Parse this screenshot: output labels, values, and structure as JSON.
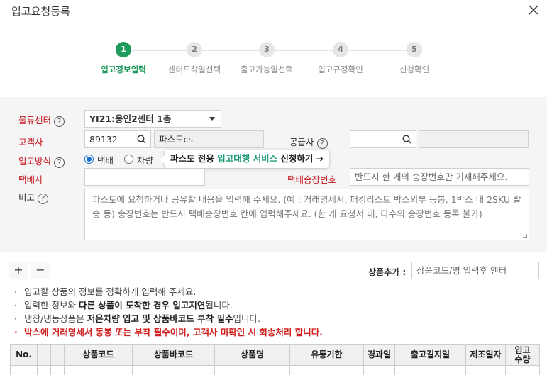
{
  "dialog": {
    "title": "입고요청등록"
  },
  "steps": [
    {
      "num": "1",
      "label": "입고정보입력",
      "active": true
    },
    {
      "num": "2",
      "label": "센터도착일선택",
      "active": false
    },
    {
      "num": "3",
      "label": "출고가능일선택",
      "active": false
    },
    {
      "num": "4",
      "label": "입고규정확인",
      "active": false
    },
    {
      "num": "5",
      "label": "신청확인",
      "active": false
    }
  ],
  "form": {
    "center_label": "물류센터",
    "center_value": "YI21:용인2센터 1층",
    "customer_label": "고객사",
    "customer_code": "89132",
    "customer_name": "파스토cs",
    "supplier_label": "공급사",
    "supplier_code": "",
    "supplier_name": "",
    "method_label": "입고방식",
    "method_options": [
      "택배",
      "차량"
    ],
    "method_selected": "택배",
    "promo_prefix": "파스토 전용 ",
    "promo_highlight": "입고대행 서비스",
    "promo_suffix": " 신청하기 ➔",
    "courier_label": "택배사",
    "courier_value": "",
    "invoice_label": "택배송장번호",
    "invoice_placeholder": "반드시 한 개의 송장번호만 기재해주세요.",
    "memo_label": "비고",
    "memo_placeholder": "파스토에 요청하거나 공유할 내용을 입력해 주세요. (예 : 거래명세서, 패킹리스트 박스외부 동봉, 1박스 내 2SKU 발송 등) 송장번호는 반드시 택배송장번호 칸에 입력해주세요. (한 개 요청서 내, 다수의 송장번호 등록 불가)"
  },
  "toolbar": {
    "add": "+",
    "remove": "−",
    "product_add_label": "상품추가 :",
    "product_add_placeholder": "상품코드/명 입력후 엔터"
  },
  "notes": {
    "line1": "입고할 상품의 정보를 정확하게 입력해 주세요.",
    "line2_a": "입력한 정보와 ",
    "line2_b": "다른 상품이 도착한 경우 입고지연",
    "line2_c": "됩니다.",
    "line3_a": "냉장/냉동상품은 ",
    "line3_b": "저온차량 입고 및 상품바코드 부착 필수",
    "line3_c": "입니다.",
    "line4": "박스에 거래명세서 동봉 또는 부착 필수이며, 고객사 미확인 시 회송처리 합니다."
  },
  "table": {
    "columns": [
      "No.",
      "",
      "",
      "상품코드",
      "상품바코드",
      "상품명",
      "유통기한",
      "경과일",
      "출고길지일",
      "제조일자",
      "입고\n수량"
    ]
  },
  "colors": {
    "accent": "#1e9b5a",
    "required": "#c4161c",
    "warning": "#d02020",
    "panel_bg": "#f5f5f5"
  }
}
